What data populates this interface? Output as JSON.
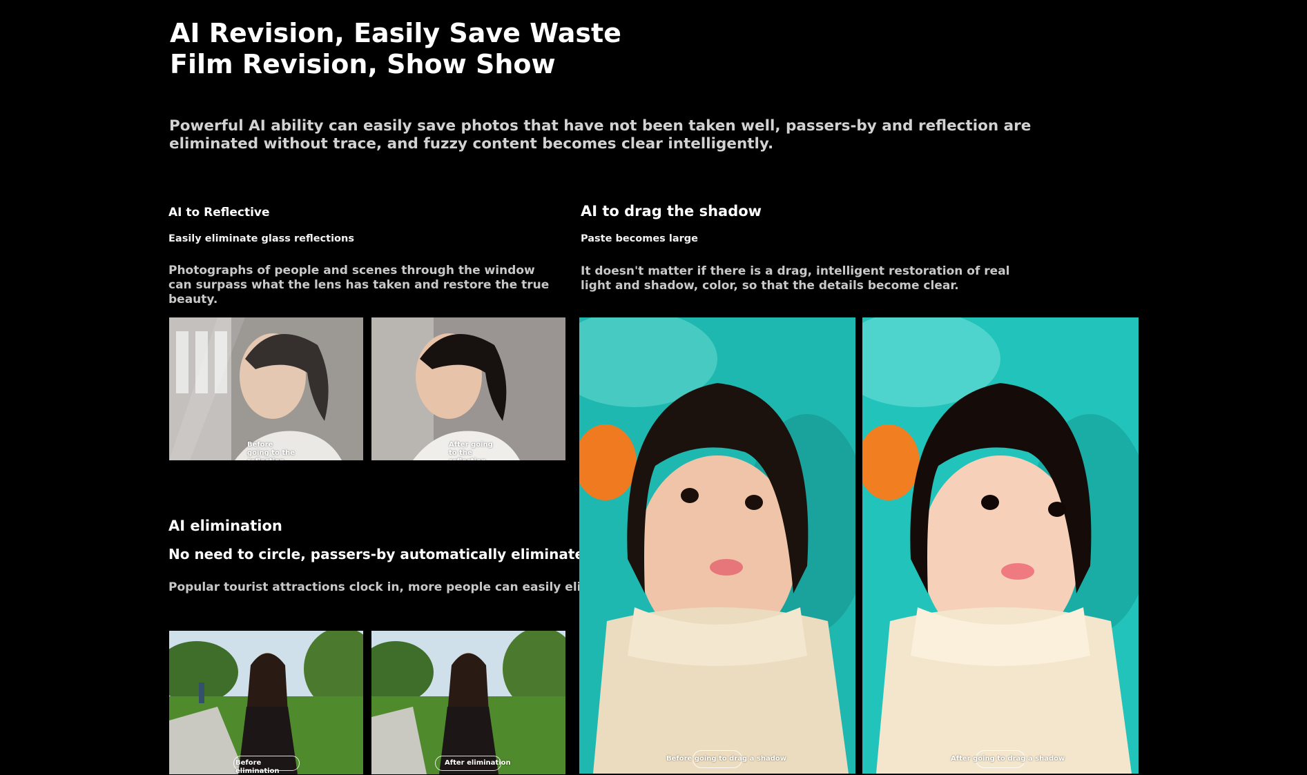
{
  "header": {
    "title_line1": "AI Revision, Easily Save Waste",
    "title_line2": "Film Revision, Show Show",
    "intro": "Powerful AI ability can easily save photos that have not been taken well, passers-by and reflection are eliminated without trace, and fuzzy content becomes clear intelligently."
  },
  "reflective": {
    "heading": "AI to Reflective",
    "subheading": "Easily eliminate glass reflections",
    "description": "Photographs of people and scenes through the window can surpass what the lens has taken and restore the true beauty.",
    "before_caption": "Before going to the reflection",
    "after_caption": "After going to the reflection"
  },
  "shadow": {
    "heading": "AI to drag the shadow",
    "subheading": "Paste becomes large",
    "description": "It doesn't matter if there is a drag, intelligent restoration of real light and shadow, color, so that the details become clear.",
    "before_caption": "Before going to drag a shadow",
    "after_caption": "After going to drag a shadow"
  },
  "elimination": {
    "heading": "AI elimination",
    "subheading": "No need to circle, passers-by automatically eliminate",
    "description": "Popular tourist attractions clock in, more people can easily eliminate.",
    "before_caption": "Before elimination",
    "after_caption": "After elimination"
  },
  "colors": {
    "background": "#000000",
    "text": "#ffffff",
    "muted_text": "#c8c8c8",
    "aquarium": "#1fb8b0",
    "fish": "#f07a20",
    "grass": "#4f8a2c"
  }
}
